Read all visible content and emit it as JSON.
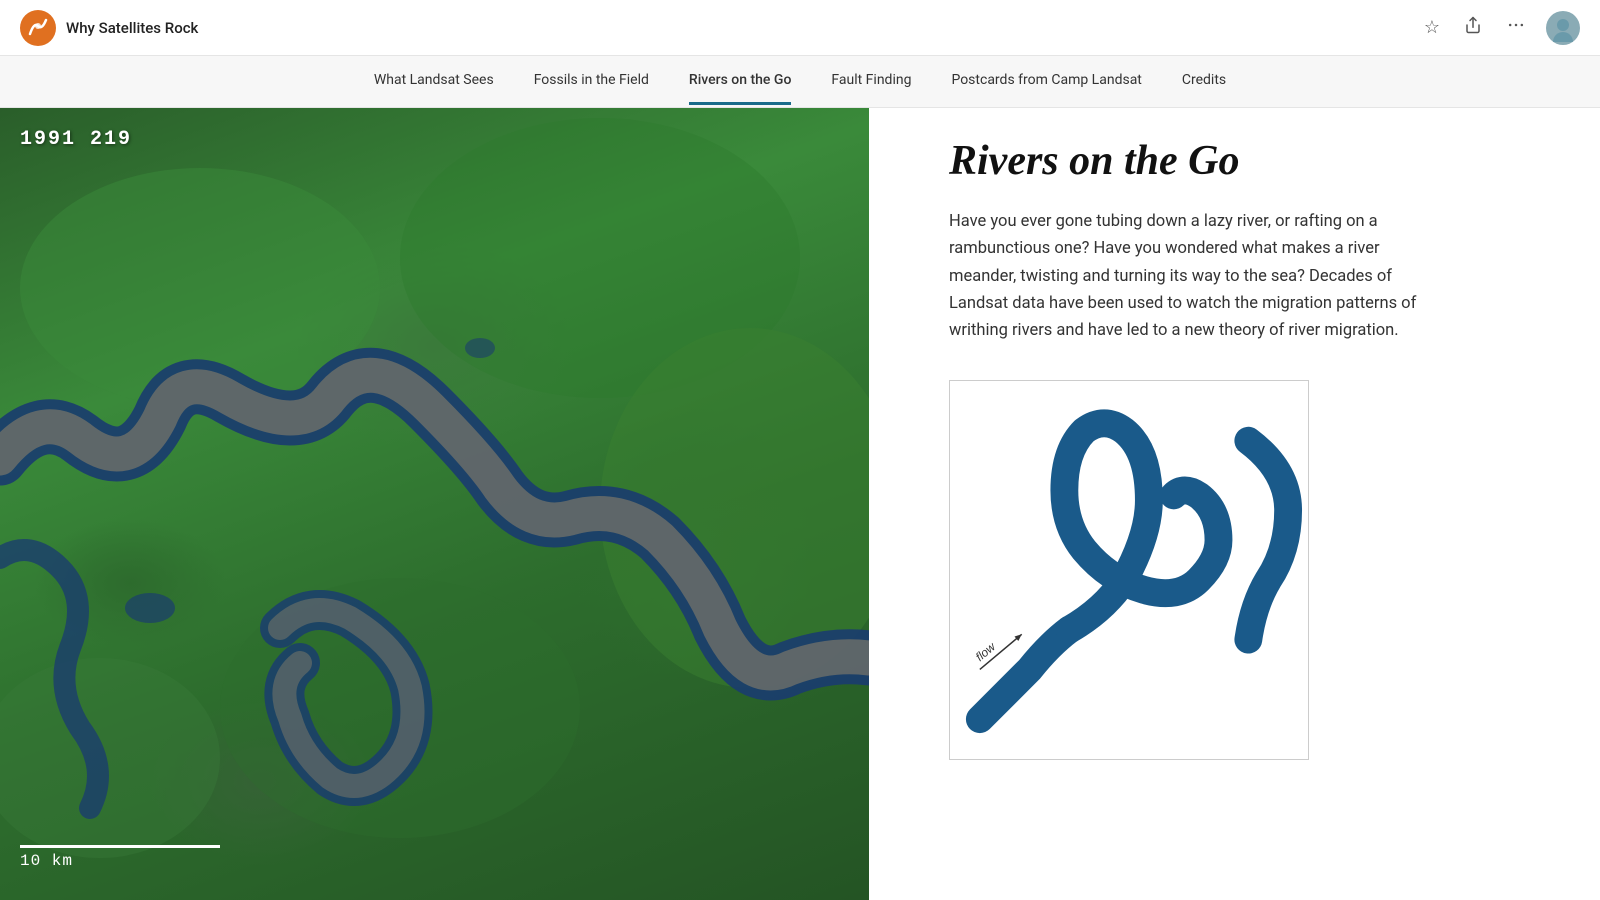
{
  "header": {
    "app_title": "Why Satellites Rock",
    "logo_color": "#e07020"
  },
  "nav": {
    "items": [
      {
        "id": "what-landsat-sees",
        "label": "What Landsat Sees",
        "active": false
      },
      {
        "id": "fossils-in-the-field",
        "label": "Fossils in the Field",
        "active": false
      },
      {
        "id": "rivers-on-the-go",
        "label": "Rivers on the Go",
        "active": true
      },
      {
        "id": "fault-finding",
        "label": "Fault Finding",
        "active": false
      },
      {
        "id": "postcards-from-camp-landsat",
        "label": "Postcards from Camp Landsat",
        "active": false
      },
      {
        "id": "credits",
        "label": "Credits",
        "active": false
      }
    ]
  },
  "image": {
    "label": "1991 219",
    "scale_text": "10 km"
  },
  "content": {
    "title": "Rivers on the Go",
    "body": "Have you ever gone tubing down a lazy river, or rafting on a rambunctious one? Have you wondered what makes a river meander, twisting and turning its way to the sea? Decades of Landsat data have been used to watch the migration patterns of writhing rivers and have led to a new theory of river migration."
  },
  "diagram": {
    "flow_label": "flow"
  },
  "icons": {
    "star": "☆",
    "share": "↑",
    "more": "···"
  }
}
